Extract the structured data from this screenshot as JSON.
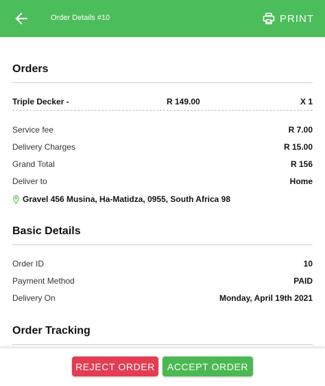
{
  "header": {
    "title": "Order Details #10",
    "print_label": "PRINT",
    "color": "#4cbd5b",
    "back_icon": "arrow-left-icon",
    "print_icon": "printer-icon"
  },
  "orders": {
    "title": "Orders",
    "items": [
      {
        "name": "Triple Decker -",
        "price": "R 149.00",
        "qty": "X 1"
      }
    ],
    "summary": [
      {
        "label": "Service fee",
        "value": "R 7.00"
      },
      {
        "label": "Delivery Charges",
        "value": "R 15.00"
      },
      {
        "label": "Grand Total",
        "value": "R 156"
      },
      {
        "label": "Deliver to",
        "value": "Home"
      }
    ],
    "address": "Gravel 456 Musina, Ha-Matidza, 0955, South Africa 98",
    "address_icon": "location-pin-icon"
  },
  "basic": {
    "title": "Basic Details",
    "rows": [
      {
        "label": "Order ID",
        "value": "10"
      },
      {
        "label": "Payment Method",
        "value": "PAID"
      },
      {
        "label": "Delivery On",
        "value": "Monday, April 19th 2021"
      }
    ]
  },
  "tracking": {
    "title": "Order Tracking"
  },
  "footer": {
    "reject_label": "REJECT ORDER",
    "accept_label": "ACCEPT ORDER",
    "reject_color": "#e23d52",
    "accept_color": "#4cb853"
  }
}
